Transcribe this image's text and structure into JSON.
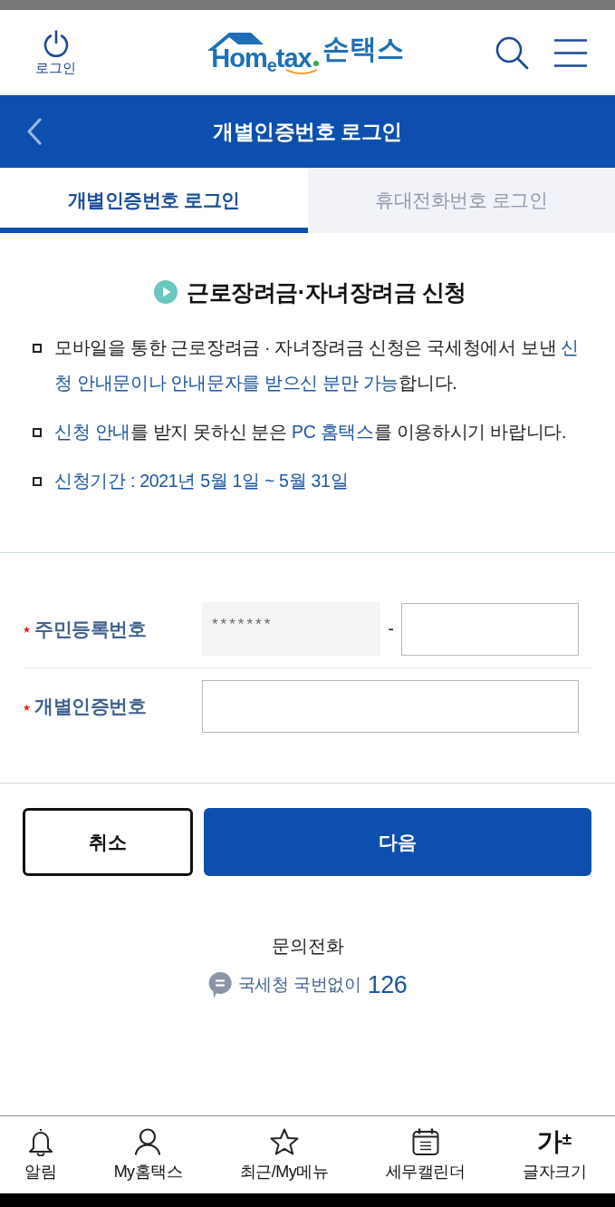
{
  "header": {
    "login": {
      "label": "로그인"
    },
    "logo": {
      "wordmark": "Hom$_{e}$tax",
      "suffix": "손택스"
    }
  },
  "page_bar": {
    "title": "개별인증번호 로그인"
  },
  "tabs": [
    {
      "label": "개별인증번호 로그인",
      "selected": true
    },
    {
      "label": "휴대전화번호 로그인",
      "selected": false
    }
  ],
  "notice": {
    "title": "근로장려금·자녀장려금 신청",
    "items": [
      {
        "segments": [
          {
            "text": "모바일을 통한 근로장려금 · 자녀장려금 신청은 국세청에서 보낸 ",
            "highlight": false
          },
          {
            "text": "신청 안내문이나 안내문자를 받으신 분만 가능",
            "highlight": true
          },
          {
            "text": "합니다.",
            "highlight": false
          }
        ]
      },
      {
        "segments": [
          {
            "text": "신청 안내",
            "highlight": true
          },
          {
            "text": "를 받지 못하신 분은 ",
            "highlight": false
          },
          {
            "text": "PC 홈택스",
            "highlight": true
          },
          {
            "text": "를 이용하시기 바랍니다.",
            "highlight": false
          }
        ]
      },
      {
        "segments": [
          {
            "text": "신청기간 : 2021년 5월 1일 ~ 5월 31일",
            "highlight": true
          }
        ]
      }
    ]
  },
  "form": {
    "fields": [
      {
        "label": "주민등록번호",
        "required": true,
        "separator": "-",
        "inputs": [
          {
            "value": "*******",
            "disabled": true
          },
          {
            "disabled": false
          }
        ]
      },
      {
        "label": "개별인증번호",
        "required": true,
        "inputs": [
          {
            "disabled": false
          }
        ]
      }
    ]
  },
  "buttons": [
    {
      "label": "취소",
      "kind": "secondary"
    },
    {
      "label": "다음",
      "kind": "primary"
    }
  ],
  "contact": {
    "title": "문의전화",
    "label": "국세청 국번없이",
    "number": "126"
  },
  "bottom_nav": [
    {
      "label": "알림"
    },
    {
      "label": "My홈택스"
    },
    {
      "label": "최근/My메뉴"
    },
    {
      "label": "세무캘린더"
    },
    {
      "label": "글자크기",
      "glyph": "가$^{±}$"
    }
  ]
}
